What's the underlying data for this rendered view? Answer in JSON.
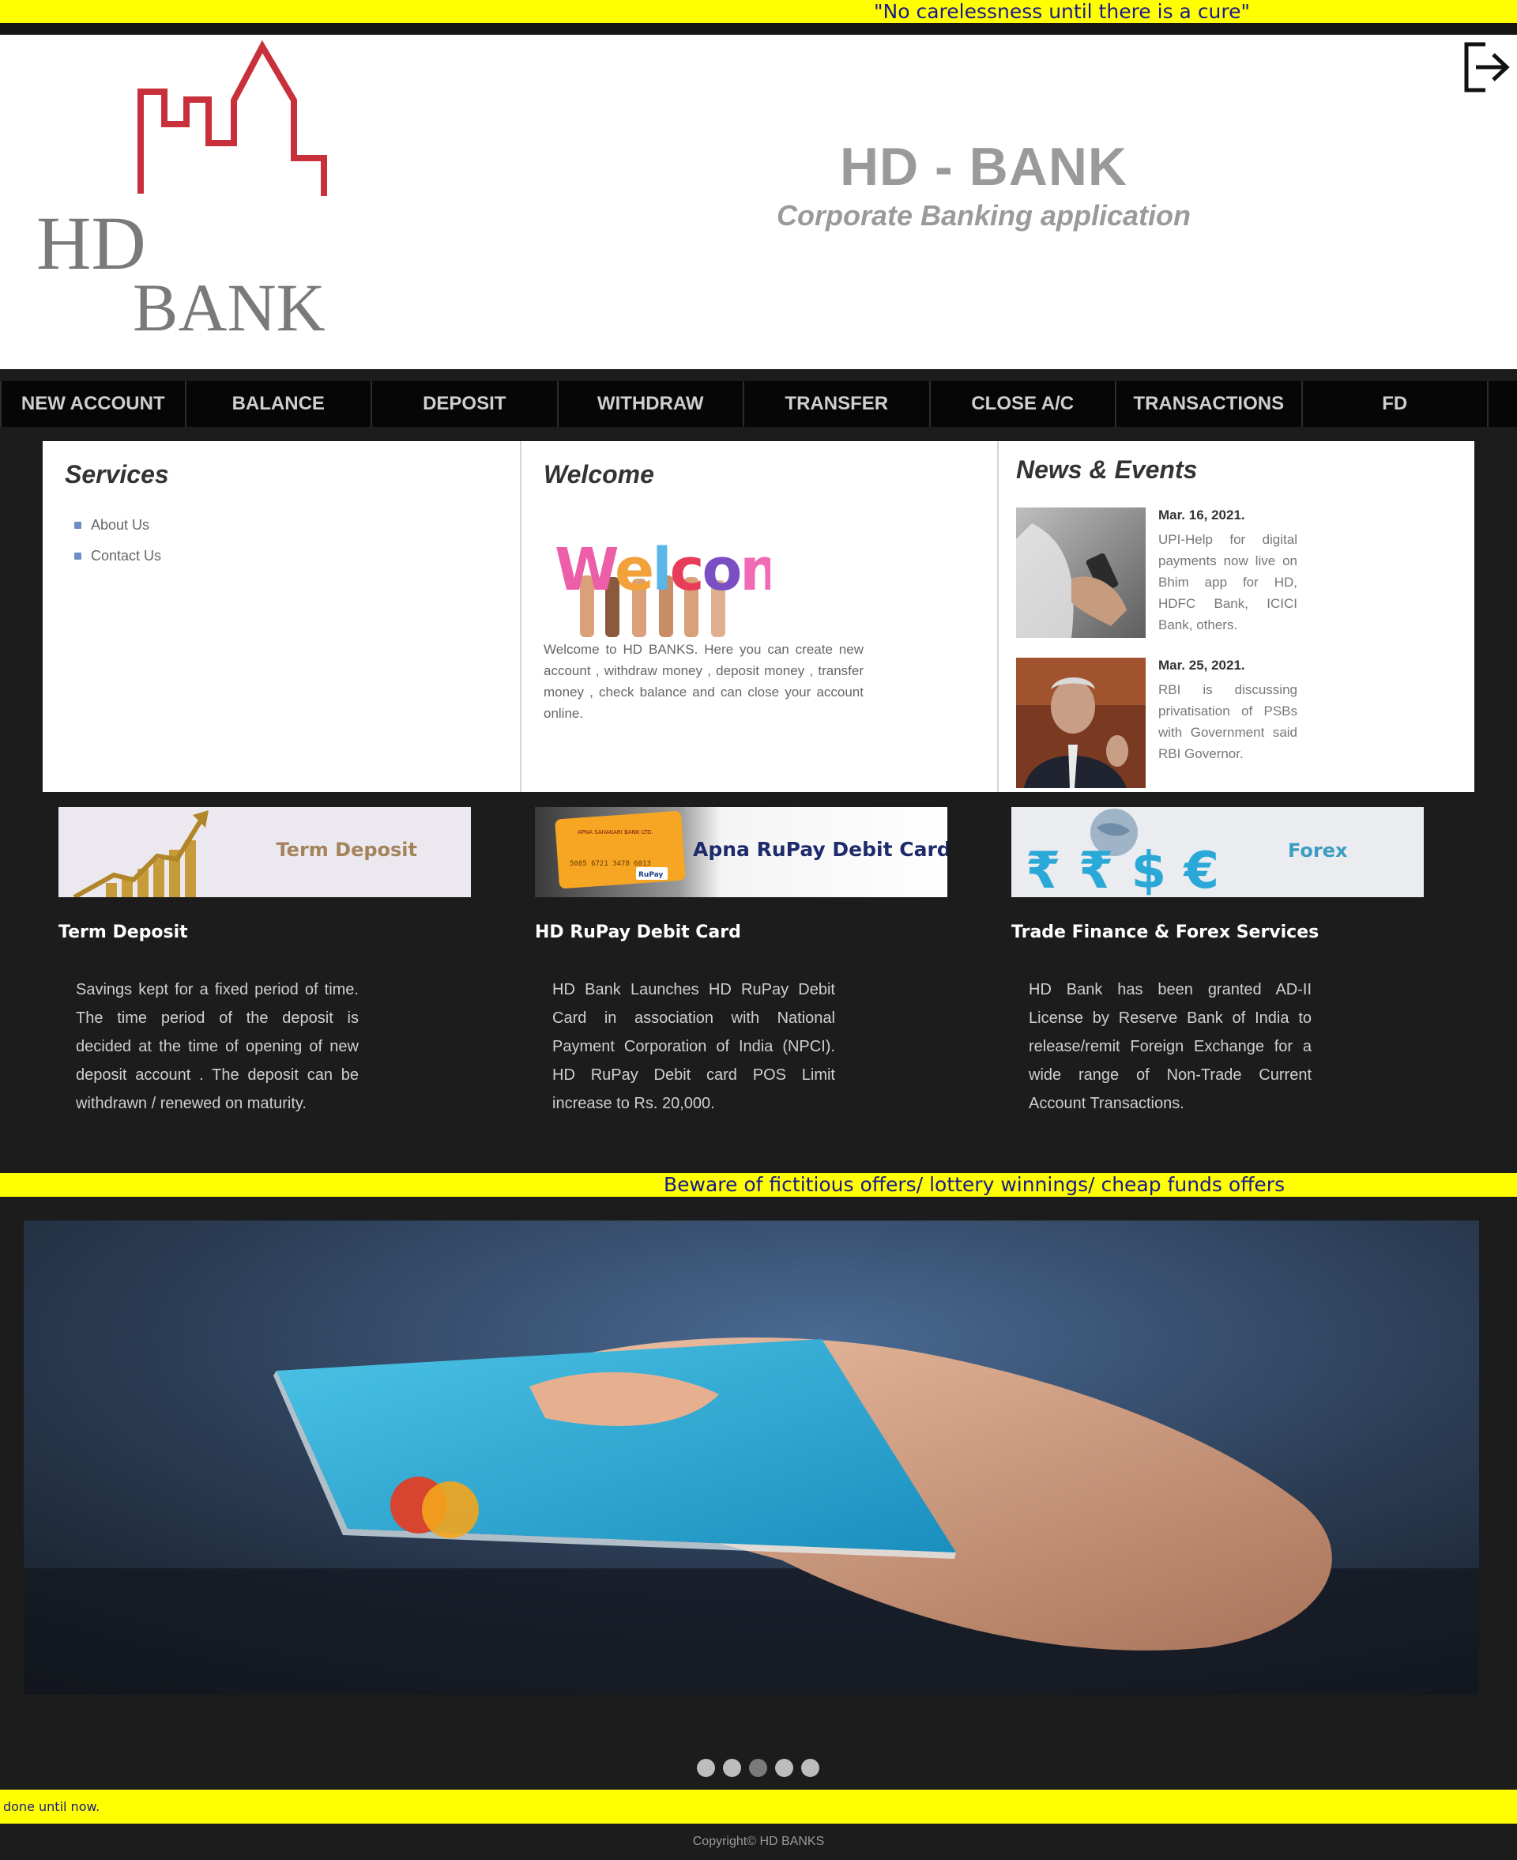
{
  "marquee_top": "\"No carelessness until there is a cure\"",
  "header": {
    "logo_top": "HD",
    "logo_bottom": "BANK",
    "title": "HD - BANK",
    "subtitle": "Corporate Banking application",
    "logout_icon": "logout-icon"
  },
  "nav": [
    "NEW ACCOUNT",
    "BALANCE",
    "DEPOSIT",
    "WITHDRAW",
    "TRANSFER",
    "CLOSE A/C",
    "TRANSACTIONS",
    "FD"
  ],
  "services": {
    "title": "Services",
    "items": [
      "About Us",
      "Contact Us"
    ]
  },
  "welcome": {
    "title": "Welcome",
    "image_word": "Welcome",
    "text": "Welcome to HD BANKS. Here you can create new account , withdraw money , deposit money , transfer money , check balance and can close your account online."
  },
  "news": {
    "title": "News & Events",
    "items": [
      {
        "date": "Mar. 16, 2021.",
        "text": "UPI-Help for digital payments now live on Bhim app for HD, HDFC Bank, ICICI Bank, others."
      },
      {
        "date": "Mar. 25, 2021.",
        "text": "RBI is discussing privatisation of PSBs with Government said RBI Governor."
      }
    ]
  },
  "promos": [
    {
      "banner_text": "Term Deposit",
      "title": "Term Deposit",
      "text": "Savings kept for a fixed period of time. The time period of the deposit is decided at the time of opening of new deposit account . The deposit can be withdrawn / renewed on maturity."
    },
    {
      "banner_text": "Apna RuPay Debit Card",
      "card_bank": "APNA SAHAKARI BANK LTD.",
      "card_number": "5085 6721 3478 6013",
      "card_brand": "RuPay",
      "title": "HD RuPay Debit Card",
      "text": "HD Bank Launches HD RuPay Debit Card in association with National Payment Corporation of India (NPCI). HD RuPay Debit card POS Limit increase to Rs. 20,000."
    },
    {
      "banner_text": "Forex",
      "symbols": "₹ ₹ $ €",
      "title": "Trade Finance & Forex Services",
      "text": "HD Bank has been granted AD-II License by Reserve Bank of India to release/remit Foreign Exchange for a wide range of Non-Trade Current Account Transactions."
    }
  ],
  "marquee_mid": "Beware of fictitious offers/ lottery winnings/ cheap funds offers",
  "slider": {
    "count": 5,
    "active": 3
  },
  "marquee_bottom": "done until now.",
  "footer": "Copyright© HD BANKS",
  "colors": {
    "marquee_bg": "#ffff00",
    "marquee_text": "#1a1a8c",
    "page_bg": "#1c1c1c",
    "nav_bg": "#060606",
    "logo_red": "#c8313b"
  }
}
